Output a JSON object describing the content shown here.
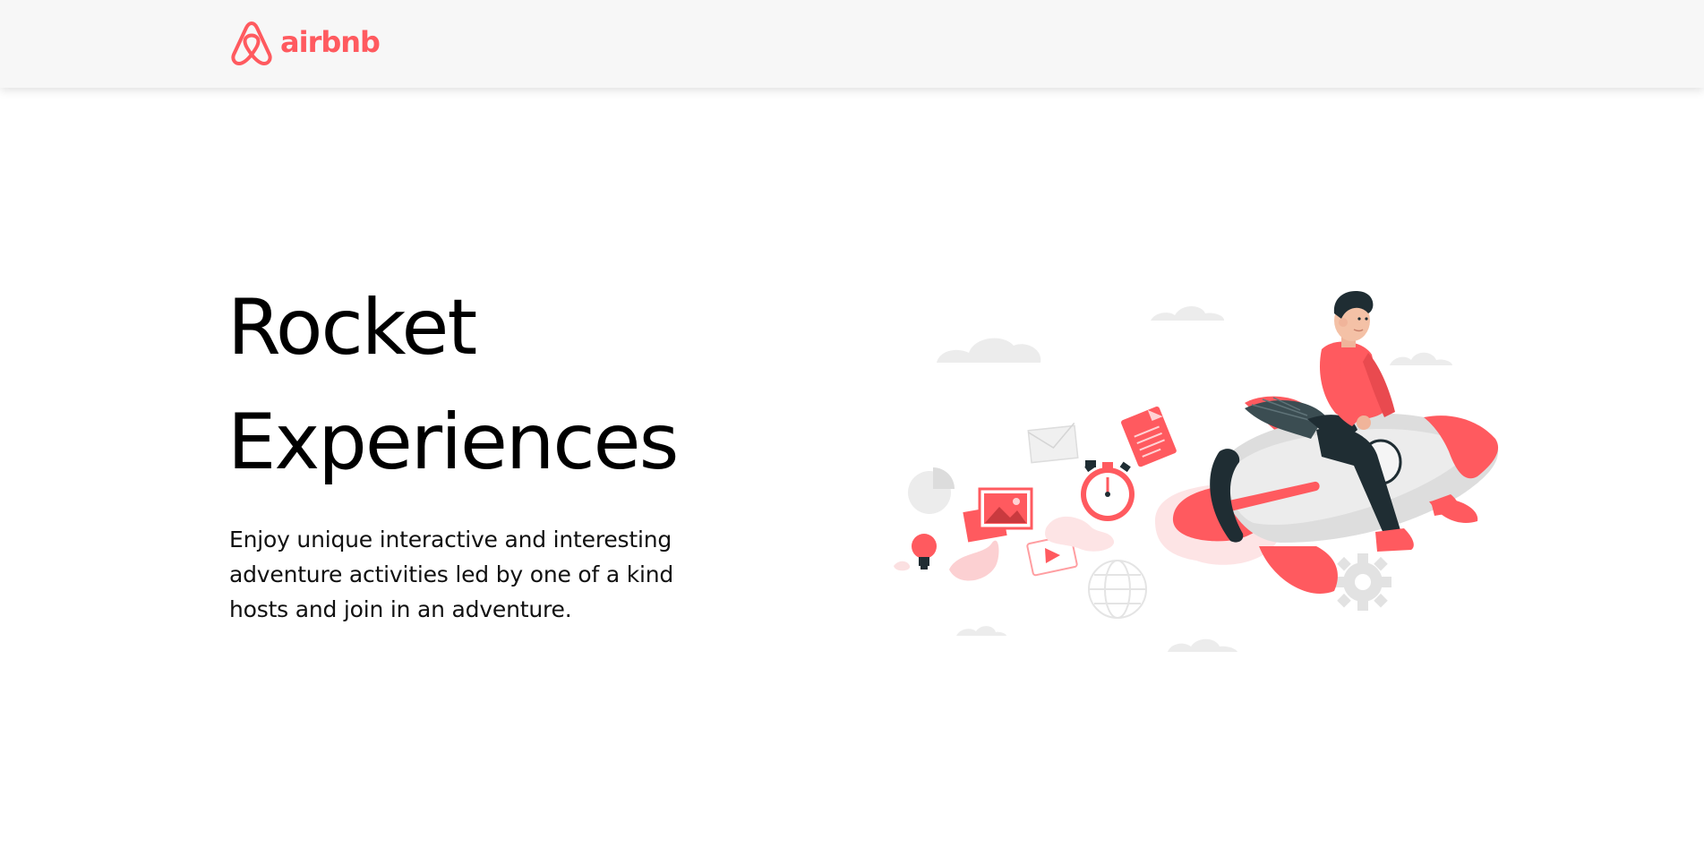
{
  "header": {
    "logo_text": "airbnb",
    "logo_icon": "airbnb-belo-icon"
  },
  "hero": {
    "title_line1": "Rocket",
    "title_line2": "Experiences",
    "description": "Enjoy unique interactive and interesting adventure activities led by one of a kind hosts and join in an adventure.",
    "illustration": "rocket-rider-illustration"
  },
  "colors": {
    "brand": "#ff5a5f",
    "header_bg": "#f7f7f7",
    "text": "#000000",
    "accent_dark": "#1f2d33",
    "light_gray": "#ececec"
  }
}
